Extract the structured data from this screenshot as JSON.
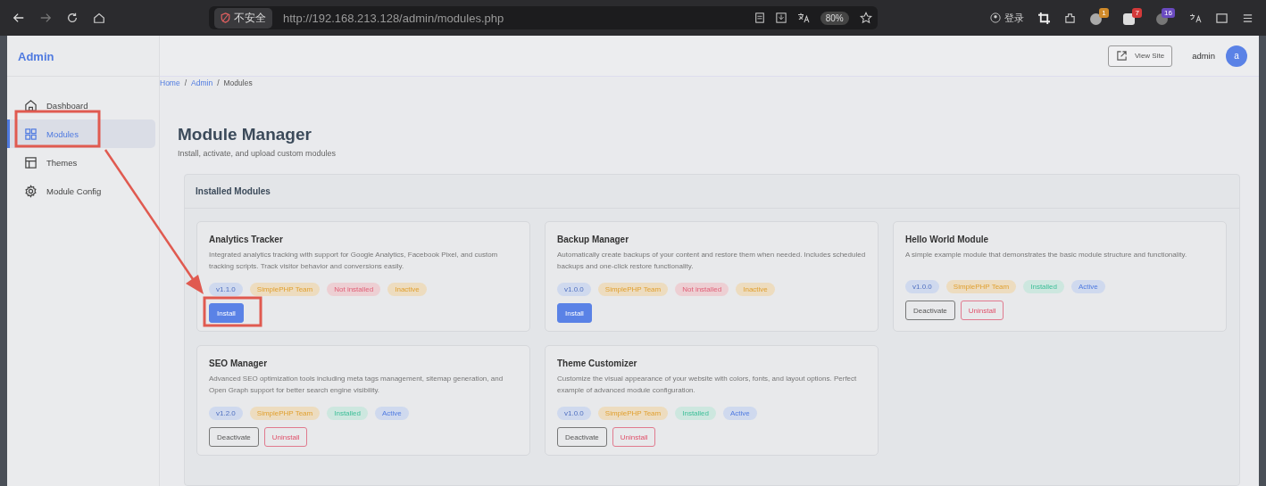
{
  "browser": {
    "security": "不安全",
    "url": "http://192.168.213.128/admin/modules.php",
    "zoom": "80%",
    "login": "登录",
    "extension_badges": [
      "1",
      "7",
      "16"
    ]
  },
  "sidebar": {
    "brand": "Admin",
    "items": [
      {
        "label": "Dashboard",
        "kind": "home",
        "selected": false
      },
      {
        "label": "Modules",
        "kind": "grid",
        "selected": true
      },
      {
        "label": "Themes",
        "kind": "layout",
        "selected": false
      },
      {
        "label": "Module Config",
        "kind": "gear",
        "selected": false
      }
    ]
  },
  "header": {
    "view_site": "View Site",
    "user": "admin",
    "avatar": "a"
  },
  "breadcrumb": [
    {
      "label": "Home",
      "link": true
    },
    {
      "label": "Admin",
      "link": true
    },
    {
      "label": "Modules",
      "link": false
    }
  ],
  "breadcrumb_separator": "/",
  "page": {
    "title": "Module Manager",
    "subtitle": "Install, activate, and upload custom modules"
  },
  "panel": {
    "title": "Installed Modules",
    "modules": [
      {
        "name": "Analytics Tracker",
        "description": "Integrated analytics tracking with support for Google Analytics, Facebook Pixel, and custom tracking scripts. Track visitor behavior and conversions easily.",
        "badges": [
          {
            "text": "v1.1.0",
            "kind": "version"
          },
          {
            "text": "SimplePHP Team",
            "kind": "author"
          },
          {
            "text": "Not installed",
            "kind": "danger"
          },
          {
            "text": "Inactive",
            "kind": "warning"
          }
        ],
        "buttons": [
          {
            "label": "Install",
            "kind": "primary"
          }
        ]
      },
      {
        "name": "Backup Manager",
        "description": "Automatically create backups of your content and restore them when needed. Includes scheduled backups and one-click restore functionality.",
        "badges": [
          {
            "text": "v1.0.0",
            "kind": "version"
          },
          {
            "text": "SimplePHP Team",
            "kind": "author"
          },
          {
            "text": "Not installed",
            "kind": "danger"
          },
          {
            "text": "Inactive",
            "kind": "warning"
          }
        ],
        "buttons": [
          {
            "label": "Install",
            "kind": "primary"
          }
        ]
      },
      {
        "name": "Hello World Module",
        "description": "A simple example module that demonstrates the basic module structure and functionality.",
        "badges": [
          {
            "text": "v1.0.0",
            "kind": "version"
          },
          {
            "text": "SimplePHP Team",
            "kind": "author"
          },
          {
            "text": "Installed",
            "kind": "success"
          },
          {
            "text": "Active",
            "kind": "info"
          }
        ],
        "buttons": [
          {
            "label": "Deactivate",
            "kind": "outline"
          },
          {
            "label": "Uninstall",
            "kind": "danger"
          }
        ]
      },
      {
        "name": "SEO Manager",
        "description": "Advanced SEO optimization tools including meta tags management, sitemap generation, and Open Graph support for better search engine visibility.",
        "badges": [
          {
            "text": "v1.2.0",
            "kind": "version"
          },
          {
            "text": "SimplePHP Team",
            "kind": "author"
          },
          {
            "text": "Installed",
            "kind": "success"
          },
          {
            "text": "Active",
            "kind": "info"
          }
        ],
        "buttons": [
          {
            "label": "Deactivate",
            "kind": "outline"
          },
          {
            "label": "Uninstall",
            "kind": "danger"
          }
        ]
      },
      {
        "name": "Theme Customizer",
        "description": "Customize the visual appearance of your website with colors, fonts, and layout options. Perfect example of advanced module configuration.",
        "badges": [
          {
            "text": "v1.0.0",
            "kind": "version"
          },
          {
            "text": "SimplePHP Team",
            "kind": "author"
          },
          {
            "text": "Installed",
            "kind": "success"
          },
          {
            "text": "Active",
            "kind": "info"
          }
        ],
        "buttons": [
          {
            "label": "Deactivate",
            "kind": "outline"
          },
          {
            "label": "Uninstall",
            "kind": "danger"
          }
        ]
      }
    ]
  }
}
